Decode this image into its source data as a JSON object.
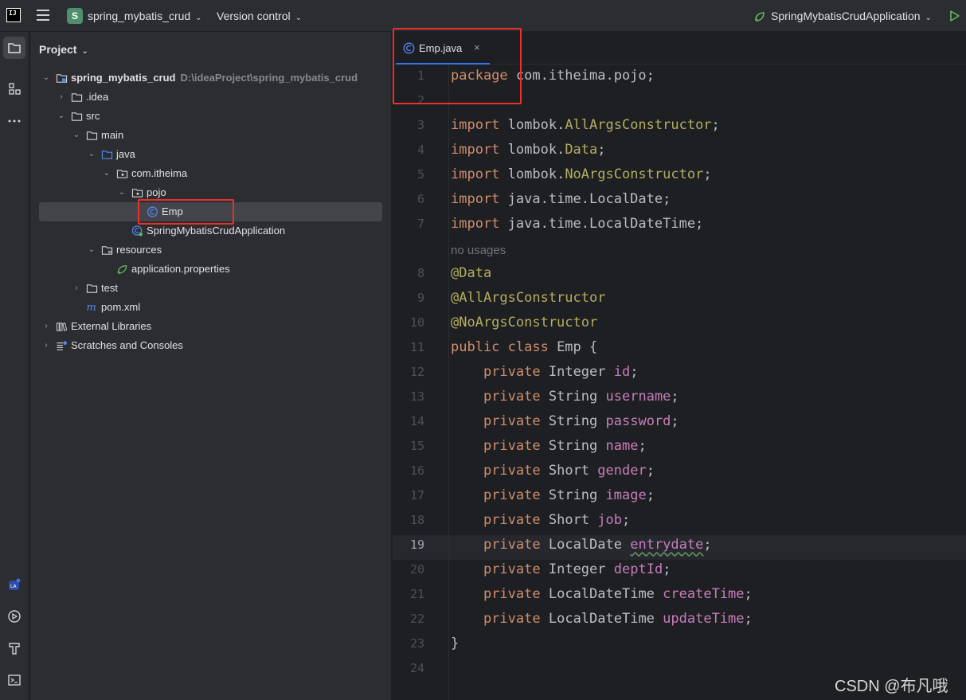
{
  "titlebar": {
    "logo": "IJ",
    "project_initial": "S",
    "project_name": "spring_mybatis_crud",
    "vcs_label": "Version control",
    "run_config": "SpringMybatisCrudApplication"
  },
  "project_panel": {
    "title": "Project",
    "tree": [
      {
        "label": "spring_mybatis_crud",
        "path": "D:\\ideaProject\\spring_mybatis_crud",
        "icon": "module-folder-icon",
        "expanded": true
      },
      {
        "label": ".idea",
        "icon": "folder-icon",
        "expanded": false
      },
      {
        "label": "src",
        "icon": "folder-icon",
        "expanded": true
      },
      {
        "label": "main",
        "icon": "folder-icon",
        "expanded": true
      },
      {
        "label": "java",
        "icon": "source-folder-icon",
        "expanded": true
      },
      {
        "label": "com.itheima",
        "icon": "package-icon",
        "expanded": true
      },
      {
        "label": "pojo",
        "icon": "package-icon",
        "expanded": true
      },
      {
        "label": "Emp",
        "icon": "class-icon",
        "selected": true
      },
      {
        "label": "SpringMybatisCrudApplication",
        "icon": "spring-class-icon"
      },
      {
        "label": "resources",
        "icon": "resources-folder-icon",
        "expanded": true
      },
      {
        "label": "application.properties",
        "icon": "spring-properties-icon"
      },
      {
        "label": "test",
        "icon": "folder-icon",
        "expanded": false
      },
      {
        "label": "pom.xml",
        "icon": "maven-icon"
      },
      {
        "label": "External Libraries",
        "icon": "libraries-icon",
        "expanded": false
      },
      {
        "label": "Scratches and Consoles",
        "icon": "scratches-icon",
        "expanded": false
      }
    ]
  },
  "editor": {
    "tab": {
      "label": "Emp.java",
      "close": "×"
    },
    "current_line": 19,
    "gutter": [
      "1",
      "2",
      "3",
      "4",
      "5",
      "6",
      "7",
      "",
      "8",
      "9",
      "10",
      "11",
      "12",
      "13",
      "14",
      "15",
      "16",
      "17",
      "18",
      "19",
      "20",
      "21",
      "22",
      "23",
      "24"
    ],
    "code": {
      "l1": {
        "kw": "package",
        "rest": " com.itheima.pojo;"
      },
      "l3": {
        "kw": "import",
        "pre": " lombok.",
        "ann": "AllArgsConstructor",
        "end": ";"
      },
      "l4": {
        "kw": "import",
        "pre": " lombok.",
        "ann": "Data",
        "end": ";"
      },
      "l5": {
        "kw": "import",
        "pre": " lombok.",
        "ann": "NoArgsConstructor",
        "end": ";"
      },
      "l6": {
        "kw": "import",
        "rest": " java.time.LocalDate;"
      },
      "l7": {
        "kw": "import",
        "rest": " java.time.LocalDateTime;"
      },
      "hint": "no usages",
      "l8": "@Data",
      "l9": "@AllArgsConstructor",
      "l10": "@NoArgsConstructor",
      "l11": {
        "kw": "public class",
        "rest": " Emp {"
      },
      "fields": [
        {
          "type": "Integer",
          "name": "id"
        },
        {
          "type": "String",
          "name": "username"
        },
        {
          "type": "String",
          "name": "password"
        },
        {
          "type": "String",
          "name": "name"
        },
        {
          "type": "Short",
          "name": "gender"
        },
        {
          "type": "String",
          "name": "image"
        },
        {
          "type": "Short",
          "name": "job"
        },
        {
          "type": "LocalDate",
          "name": "entrydate"
        },
        {
          "type": "Integer",
          "name": "deptId"
        },
        {
          "type": "LocalDateTime",
          "name": "createTime"
        },
        {
          "type": "LocalDateTime",
          "name": "updateTime"
        }
      ],
      "private_kw": "private",
      "closing": "}"
    }
  },
  "watermark": "CSDN @布凡哦",
  "colors": {
    "highlight": "#e8302d",
    "accent": "#3574f0"
  }
}
